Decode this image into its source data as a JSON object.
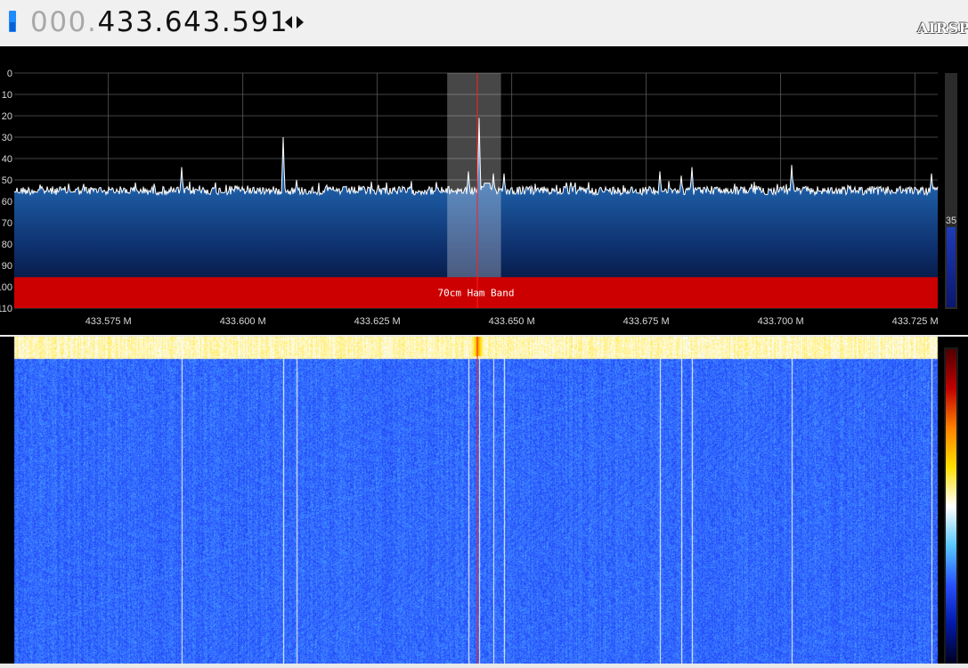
{
  "frequency": {
    "dim_prefix": "000.",
    "main": "433.643.591"
  },
  "branding": {
    "logo_text": "AIRSPY"
  },
  "spectrum": {
    "y_ticks": [
      "0",
      "10",
      "20",
      "30",
      "40",
      "50",
      "60",
      "70",
      "80",
      "90",
      "100",
      "110"
    ],
    "x_ticks": [
      "433.575 M",
      "433.600 M",
      "433.625 M",
      "433.650 M",
      "433.675 M",
      "433.700 M",
      "433.725 M"
    ],
    "band_label": "70cm Ham Band",
    "band_color": "#cc0000",
    "gain_value": "35",
    "noise_floor_level": 55,
    "peaks_dbm": [
      {
        "freq": 433.5887,
        "level": 44
      },
      {
        "freq": 433.6075,
        "level": 30
      },
      {
        "freq": 433.61,
        "level": 50
      },
      {
        "freq": 433.642,
        "level": 46
      },
      {
        "freq": 433.644,
        "level": 21
      },
      {
        "freq": 433.6465,
        "level": 47
      },
      {
        "freq": 433.6485,
        "level": 47
      },
      {
        "freq": 433.6775,
        "level": 46
      },
      {
        "freq": 433.6815,
        "level": 48
      },
      {
        "freq": 433.6835,
        "level": 44
      },
      {
        "freq": 433.702,
        "level": 43
      },
      {
        "freq": 433.728,
        "level": 47
      }
    ],
    "selection_color": "#ffffff",
    "tuning_line_color": "#ff2020"
  },
  "waterfall": {
    "colormap": [
      "#000020",
      "#0019a6",
      "#2850ff",
      "#58c8ff",
      "#ffffff",
      "#ffe000",
      "#ff8000",
      "#c00000",
      "#500000"
    ],
    "signal_freqs": [
      433.5887,
      433.6075,
      433.61,
      433.642,
      433.644,
      433.6465,
      433.6485,
      433.6775,
      433.6815,
      433.6835,
      433.702,
      433.728
    ]
  }
}
